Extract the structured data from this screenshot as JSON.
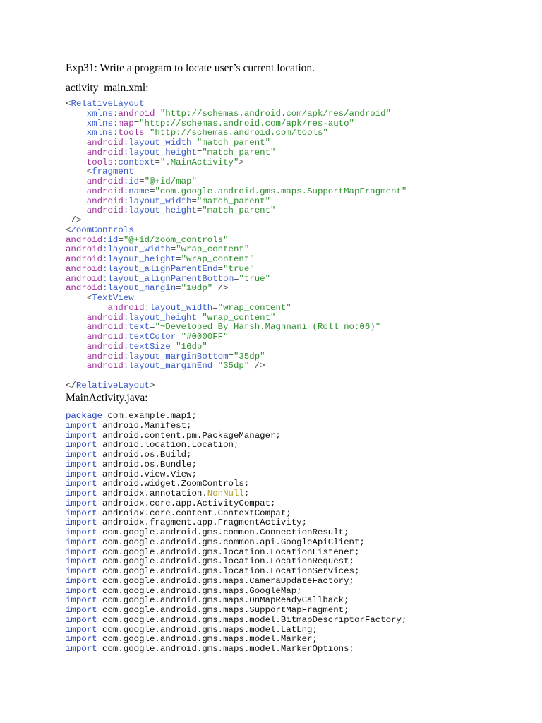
{
  "title": "Exp31: Write a program to locate user’s current location.",
  "xml_heading": "activity_main.xml:",
  "java_heading": "MainActivity.java:",
  "xml_lines": [
    [
      [
        "p",
        "<"
      ],
      [
        "t",
        "RelativeLayout"
      ]
    ],
    [
      [
        "p",
        "    "
      ],
      [
        "n",
        "xmlns:"
      ],
      [
        "a",
        "android"
      ],
      [
        "p",
        "="
      ],
      [
        "v",
        "\"http://schemas.android.com/apk/res/android\""
      ]
    ],
    [
      [
        "p",
        "    "
      ],
      [
        "n",
        "xmlns:"
      ],
      [
        "a",
        "map"
      ],
      [
        "p",
        "="
      ],
      [
        "v",
        "\"http://schemas.android.com/apk/res-auto\""
      ]
    ],
    [
      [
        "p",
        "    "
      ],
      [
        "n",
        "xmlns:"
      ],
      [
        "a",
        "tools"
      ],
      [
        "p",
        "="
      ],
      [
        "v",
        "\"http://schemas.android.com/tools\""
      ]
    ],
    [
      [
        "p",
        "    "
      ],
      [
        "a",
        "android"
      ],
      [
        "n",
        ":layout_width"
      ],
      [
        "p",
        "="
      ],
      [
        "v",
        "\"match_parent\""
      ]
    ],
    [
      [
        "p",
        "    "
      ],
      [
        "a",
        "android"
      ],
      [
        "n",
        ":layout_height"
      ],
      [
        "p",
        "="
      ],
      [
        "v",
        "\"match_parent\""
      ]
    ],
    [
      [
        "p",
        "    "
      ],
      [
        "a",
        "tools"
      ],
      [
        "n",
        ":context"
      ],
      [
        "p",
        "="
      ],
      [
        "v",
        "\".MainActivity\""
      ],
      [
        "p",
        ">"
      ]
    ],
    [
      [
        "p",
        "    <"
      ],
      [
        "t",
        "fragment"
      ]
    ],
    [
      [
        "p",
        "    "
      ],
      [
        "a",
        "android"
      ],
      [
        "n",
        ":id"
      ],
      [
        "p",
        "="
      ],
      [
        "v",
        "\"@+id/map\""
      ]
    ],
    [
      [
        "p",
        "    "
      ],
      [
        "a",
        "android"
      ],
      [
        "n",
        ":name"
      ],
      [
        "p",
        "="
      ],
      [
        "v",
        "\"com.google.android.gms.maps.SupportMapFragment\""
      ]
    ],
    [
      [
        "p",
        "    "
      ],
      [
        "a",
        "android"
      ],
      [
        "n",
        ":layout_width"
      ],
      [
        "p",
        "="
      ],
      [
        "v",
        "\"match_parent\""
      ]
    ],
    [
      [
        "p",
        "    "
      ],
      [
        "a",
        "android"
      ],
      [
        "n",
        ":layout_height"
      ],
      [
        "p",
        "="
      ],
      [
        "v",
        "\"match_parent\""
      ]
    ],
    [
      [
        "p",
        " />"
      ]
    ],
    [
      [
        "p",
        "<"
      ],
      [
        "t",
        "ZoomControls"
      ]
    ],
    [
      [
        "a",
        "android"
      ],
      [
        "n",
        ":id"
      ],
      [
        "p",
        "="
      ],
      [
        "v",
        "\"@+id/zoom_controls\""
      ]
    ],
    [
      [
        "a",
        "android"
      ],
      [
        "n",
        ":layout_width"
      ],
      [
        "p",
        "="
      ],
      [
        "v",
        "\"wrap_content\""
      ]
    ],
    [
      [
        "a",
        "android"
      ],
      [
        "n",
        ":layout_height"
      ],
      [
        "p",
        "="
      ],
      [
        "v",
        "\"wrap_content\""
      ]
    ],
    [
      [
        "a",
        "android"
      ],
      [
        "n",
        ":layout_alignParentEnd"
      ],
      [
        "p",
        "="
      ],
      [
        "v",
        "\"true\""
      ]
    ],
    [
      [
        "a",
        "android"
      ],
      [
        "n",
        ":layout_alignParentBottom"
      ],
      [
        "p",
        "="
      ],
      [
        "v",
        "\"true\""
      ]
    ],
    [
      [
        "a",
        "android"
      ],
      [
        "n",
        ":layout_margin"
      ],
      [
        "p",
        "="
      ],
      [
        "v",
        "\"10dp\""
      ],
      [
        "p",
        " />"
      ]
    ],
    [
      [
        "p",
        "    <"
      ],
      [
        "t",
        "TextView"
      ]
    ],
    [
      [
        "p",
        "        "
      ],
      [
        "a",
        "android"
      ],
      [
        "n",
        ":layout_width"
      ],
      [
        "p",
        "="
      ],
      [
        "v",
        "\"wrap_content\""
      ]
    ],
    [
      [
        "p",
        "    "
      ],
      [
        "a",
        "android"
      ],
      [
        "n",
        ":layout_height"
      ],
      [
        "p",
        "="
      ],
      [
        "v",
        "\"wrap_content\""
      ]
    ],
    [
      [
        "p",
        "    "
      ],
      [
        "a",
        "android"
      ],
      [
        "n",
        ":text"
      ],
      [
        "p",
        "="
      ],
      [
        "v",
        "\"~Developed By Harsh.Maghnani (Roll no:06)\""
      ]
    ],
    [
      [
        "p",
        "    "
      ],
      [
        "a",
        "android"
      ],
      [
        "n",
        ":textColor"
      ],
      [
        "p",
        "="
      ],
      [
        "v",
        "\"#0000FF\""
      ]
    ],
    [
      [
        "p",
        "    "
      ],
      [
        "a",
        "android"
      ],
      [
        "n",
        ":textSize"
      ],
      [
        "p",
        "="
      ],
      [
        "v",
        "\"16dp\""
      ]
    ],
    [
      [
        "p",
        "    "
      ],
      [
        "a",
        "android"
      ],
      [
        "n",
        ":layout_marginBottom"
      ],
      [
        "p",
        "="
      ],
      [
        "v",
        "\"35dp\""
      ]
    ],
    [
      [
        "p",
        "    "
      ],
      [
        "a",
        "android"
      ],
      [
        "n",
        ":layout_marginEnd"
      ],
      [
        "p",
        "="
      ],
      [
        "v",
        "\"35dp\""
      ],
      [
        "p",
        " />"
      ]
    ],
    [],
    [
      [
        "p",
        "</"
      ],
      [
        "t",
        "RelativeLayout"
      ],
      [
        "p",
        ">"
      ]
    ]
  ],
  "java_lines": [
    [
      [
        "k",
        "package"
      ],
      [
        "x",
        " com.example.map1;"
      ]
    ],
    [
      [
        "k",
        "import"
      ],
      [
        "x",
        " android.Manifest;"
      ]
    ],
    [
      [
        "k",
        "import"
      ],
      [
        "x",
        " android.content.pm.PackageManager;"
      ]
    ],
    [
      [
        "k",
        "import"
      ],
      [
        "x",
        " android.location.Location;"
      ]
    ],
    [
      [
        "k",
        "import"
      ],
      [
        "x",
        " android.os.Build;"
      ]
    ],
    [
      [
        "k",
        "import"
      ],
      [
        "x",
        " android.os.Bundle;"
      ]
    ],
    [
      [
        "k",
        "import"
      ],
      [
        "x",
        " android.view.View;"
      ]
    ],
    [
      [
        "k",
        "import"
      ],
      [
        "x",
        " android.widget.ZoomControls;"
      ]
    ],
    [
      [
        "k",
        "import"
      ],
      [
        "x",
        " androidx.annotation."
      ],
      [
        "o",
        "NonNull"
      ],
      [
        "x",
        ";"
      ]
    ],
    [
      [
        "k",
        "import"
      ],
      [
        "x",
        " androidx.core.app.ActivityCompat;"
      ]
    ],
    [
      [
        "k",
        "import"
      ],
      [
        "x",
        " androidx.core.content.ContextCompat;"
      ]
    ],
    [
      [
        "k",
        "import"
      ],
      [
        "x",
        " androidx.fragment.app.FragmentActivity;"
      ]
    ],
    [
      [
        "k",
        "import"
      ],
      [
        "x",
        " com.google.android.gms.common.ConnectionResult;"
      ]
    ],
    [
      [
        "k",
        "import"
      ],
      [
        "x",
        " com.google.android.gms.common.api.GoogleApiClient;"
      ]
    ],
    [
      [
        "k",
        "import"
      ],
      [
        "x",
        " com.google.android.gms.location.LocationListener;"
      ]
    ],
    [
      [
        "k",
        "import"
      ],
      [
        "x",
        " com.google.android.gms.location.LocationRequest;"
      ]
    ],
    [
      [
        "k",
        "import"
      ],
      [
        "x",
        " com.google.android.gms.location.LocationServices;"
      ]
    ],
    [
      [
        "k",
        "import"
      ],
      [
        "x",
        " com.google.android.gms.maps.CameraUpdateFactory;"
      ]
    ],
    [
      [
        "k",
        "import"
      ],
      [
        "x",
        " com.google.android.gms.maps.GoogleMap;"
      ]
    ],
    [
      [
        "k",
        "import"
      ],
      [
        "x",
        " com.google.android.gms.maps.OnMapReadyCallback;"
      ]
    ],
    [
      [
        "k",
        "import"
      ],
      [
        "x",
        " com.google.android.gms.maps.SupportMapFragment;"
      ]
    ],
    [
      [
        "k",
        "import"
      ],
      [
        "x",
        " com.google.android.gms.maps.model.BitmapDescriptorFactory;"
      ]
    ],
    [
      [
        "k",
        "import"
      ],
      [
        "x",
        " com.google.android.gms.maps.model.LatLng;"
      ]
    ],
    [
      [
        "k",
        "import"
      ],
      [
        "x",
        " com.google.android.gms.maps.model.Marker;"
      ]
    ],
    [
      [
        "k",
        "import"
      ],
      [
        "x",
        " com.google.android.gms.maps.model.MarkerOptions;"
      ]
    ]
  ]
}
